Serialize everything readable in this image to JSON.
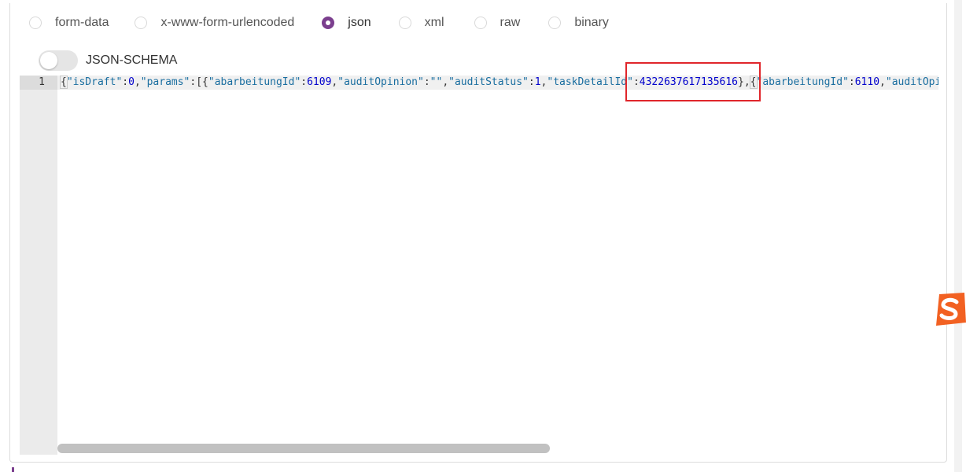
{
  "body_types": [
    {
      "label": "form-data",
      "checked": false
    },
    {
      "label": "x-www-form-urlencoded",
      "checked": false
    },
    {
      "label": "json",
      "checked": true
    },
    {
      "label": "xml",
      "checked": false
    },
    {
      "label": "raw",
      "checked": false
    },
    {
      "label": "binary",
      "checked": false
    }
  ],
  "schema_toggle": {
    "label": "JSON-SCHEMA",
    "on": false
  },
  "editor": {
    "line_number": "1",
    "tokens": [
      {
        "t": "{",
        "c": "punct",
        "m": true
      },
      {
        "t": "\"isDraft\"",
        "c": "key"
      },
      {
        "t": ":",
        "c": "punct"
      },
      {
        "t": "0",
        "c": "num"
      },
      {
        "t": ",",
        "c": "punct"
      },
      {
        "t": "\"params\"",
        "c": "key"
      },
      {
        "t": ":[{",
        "c": "punct"
      },
      {
        "t": "\"abarbeitungId\"",
        "c": "key"
      },
      {
        "t": ":",
        "c": "punct"
      },
      {
        "t": "6109",
        "c": "num"
      },
      {
        "t": ",",
        "c": "punct"
      },
      {
        "t": "\"auditOpinion\"",
        "c": "key"
      },
      {
        "t": ":",
        "c": "punct"
      },
      {
        "t": "\"\"",
        "c": "str"
      },
      {
        "t": ",",
        "c": "punct"
      },
      {
        "t": "\"auditStatus\"",
        "c": "key"
      },
      {
        "t": ":",
        "c": "punct"
      },
      {
        "t": "1",
        "c": "num"
      },
      {
        "t": ",",
        "c": "punct"
      },
      {
        "t": "\"taskDetailId\"",
        "c": "key"
      },
      {
        "t": ":",
        "c": "punct"
      },
      {
        "t": "4322637617135616",
        "c": "num"
      },
      {
        "t": "}",
        "c": "punct"
      },
      {
        "t": ",",
        "c": "punct"
      },
      {
        "t": "{",
        "c": "punct",
        "m": true
      },
      {
        "t": "\"abarbeitungId\"",
        "c": "key"
      },
      {
        "t": ":",
        "c": "punct"
      },
      {
        "t": "6110",
        "c": "num"
      },
      {
        "t": ",",
        "c": "punct"
      },
      {
        "t": "\"auditOpinion\"",
        "c": "key"
      }
    ]
  },
  "colors": {
    "accent": "#7b3f8e",
    "highlight": "#e0262b"
  },
  "icons": {
    "floating_app": "sogou-input-icon"
  }
}
